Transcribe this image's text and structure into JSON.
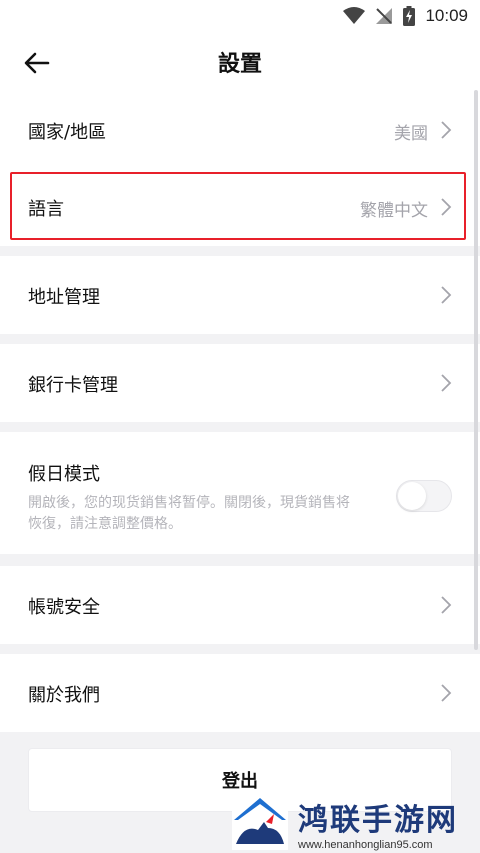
{
  "status_bar": {
    "time": "10:09"
  },
  "header": {
    "title": "設置"
  },
  "rows": {
    "region": {
      "label": "國家/地區",
      "value": "美國"
    },
    "language": {
      "label": "語言",
      "value": "繁體中文"
    },
    "address": {
      "label": "地址管理"
    },
    "bank_card": {
      "label": "銀行卡管理"
    },
    "holiday": {
      "label": "假日模式",
      "description": "開啟後，您的现货銷售将暂停。關閉後，現貨銷售将恢復，請注意調整價格。",
      "enabled": false
    },
    "account_security": {
      "label": "帳號安全"
    },
    "about": {
      "label": "關於我們"
    }
  },
  "logout": {
    "label": "登出"
  },
  "watermark": {
    "title": "鸿联手游网",
    "url": "www.henanhonglian95.com"
  },
  "colors": {
    "highlight": "#e8202a",
    "value_text": "#a4a4ab",
    "watermark_blue": "#1e3a7a"
  }
}
